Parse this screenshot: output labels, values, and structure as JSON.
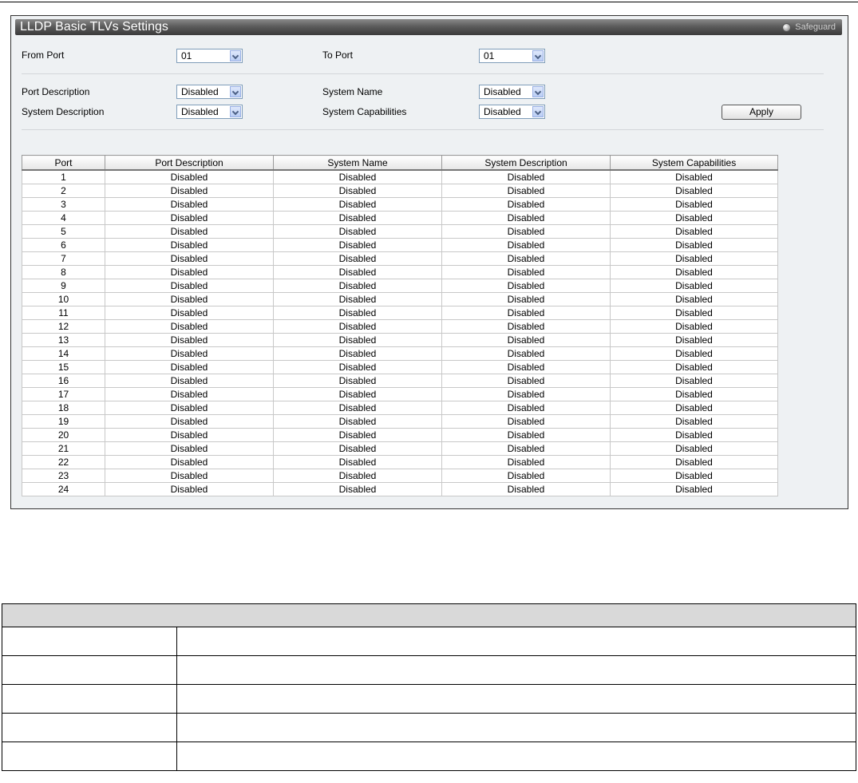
{
  "window": {
    "title": "LLDP Basic TLVs Settings",
    "safeguard_label": "Safeguard"
  },
  "form": {
    "from_port": {
      "label": "From Port",
      "value": "01"
    },
    "to_port": {
      "label": "To Port",
      "value": "01"
    },
    "port_description": {
      "label": "Port Description",
      "value": "Disabled"
    },
    "system_name": {
      "label": "System Name",
      "value": "Disabled"
    },
    "system_description": {
      "label": "System Description",
      "value": "Disabled"
    },
    "system_capabilities": {
      "label": "System Capabilities",
      "value": "Disabled"
    },
    "apply_label": "Apply"
  },
  "table": {
    "columns": [
      "Port",
      "Port Description",
      "System Name",
      "System Description",
      "System Capabilities"
    ],
    "rows": [
      [
        "1",
        "Disabled",
        "Disabled",
        "Disabled",
        "Disabled"
      ],
      [
        "2",
        "Disabled",
        "Disabled",
        "Disabled",
        "Disabled"
      ],
      [
        "3",
        "Disabled",
        "Disabled",
        "Disabled",
        "Disabled"
      ],
      [
        "4",
        "Disabled",
        "Disabled",
        "Disabled",
        "Disabled"
      ],
      [
        "5",
        "Disabled",
        "Disabled",
        "Disabled",
        "Disabled"
      ],
      [
        "6",
        "Disabled",
        "Disabled",
        "Disabled",
        "Disabled"
      ],
      [
        "7",
        "Disabled",
        "Disabled",
        "Disabled",
        "Disabled"
      ],
      [
        "8",
        "Disabled",
        "Disabled",
        "Disabled",
        "Disabled"
      ],
      [
        "9",
        "Disabled",
        "Disabled",
        "Disabled",
        "Disabled"
      ],
      [
        "10",
        "Disabled",
        "Disabled",
        "Disabled",
        "Disabled"
      ],
      [
        "11",
        "Disabled",
        "Disabled",
        "Disabled",
        "Disabled"
      ],
      [
        "12",
        "Disabled",
        "Disabled",
        "Disabled",
        "Disabled"
      ],
      [
        "13",
        "Disabled",
        "Disabled",
        "Disabled",
        "Disabled"
      ],
      [
        "14",
        "Disabled",
        "Disabled",
        "Disabled",
        "Disabled"
      ],
      [
        "15",
        "Disabled",
        "Disabled",
        "Disabled",
        "Disabled"
      ],
      [
        "16",
        "Disabled",
        "Disabled",
        "Disabled",
        "Disabled"
      ],
      [
        "17",
        "Disabled",
        "Disabled",
        "Disabled",
        "Disabled"
      ],
      [
        "18",
        "Disabled",
        "Disabled",
        "Disabled",
        "Disabled"
      ],
      [
        "19",
        "Disabled",
        "Disabled",
        "Disabled",
        "Disabled"
      ],
      [
        "20",
        "Disabled",
        "Disabled",
        "Disabled",
        "Disabled"
      ],
      [
        "21",
        "Disabled",
        "Disabled",
        "Disabled",
        "Disabled"
      ],
      [
        "22",
        "Disabled",
        "Disabled",
        "Disabled",
        "Disabled"
      ],
      [
        "23",
        "Disabled",
        "Disabled",
        "Disabled",
        "Disabled"
      ],
      [
        "24",
        "Disabled",
        "Disabled",
        "Disabled",
        "Disabled"
      ]
    ]
  },
  "description_table": {
    "rows": 5
  }
}
